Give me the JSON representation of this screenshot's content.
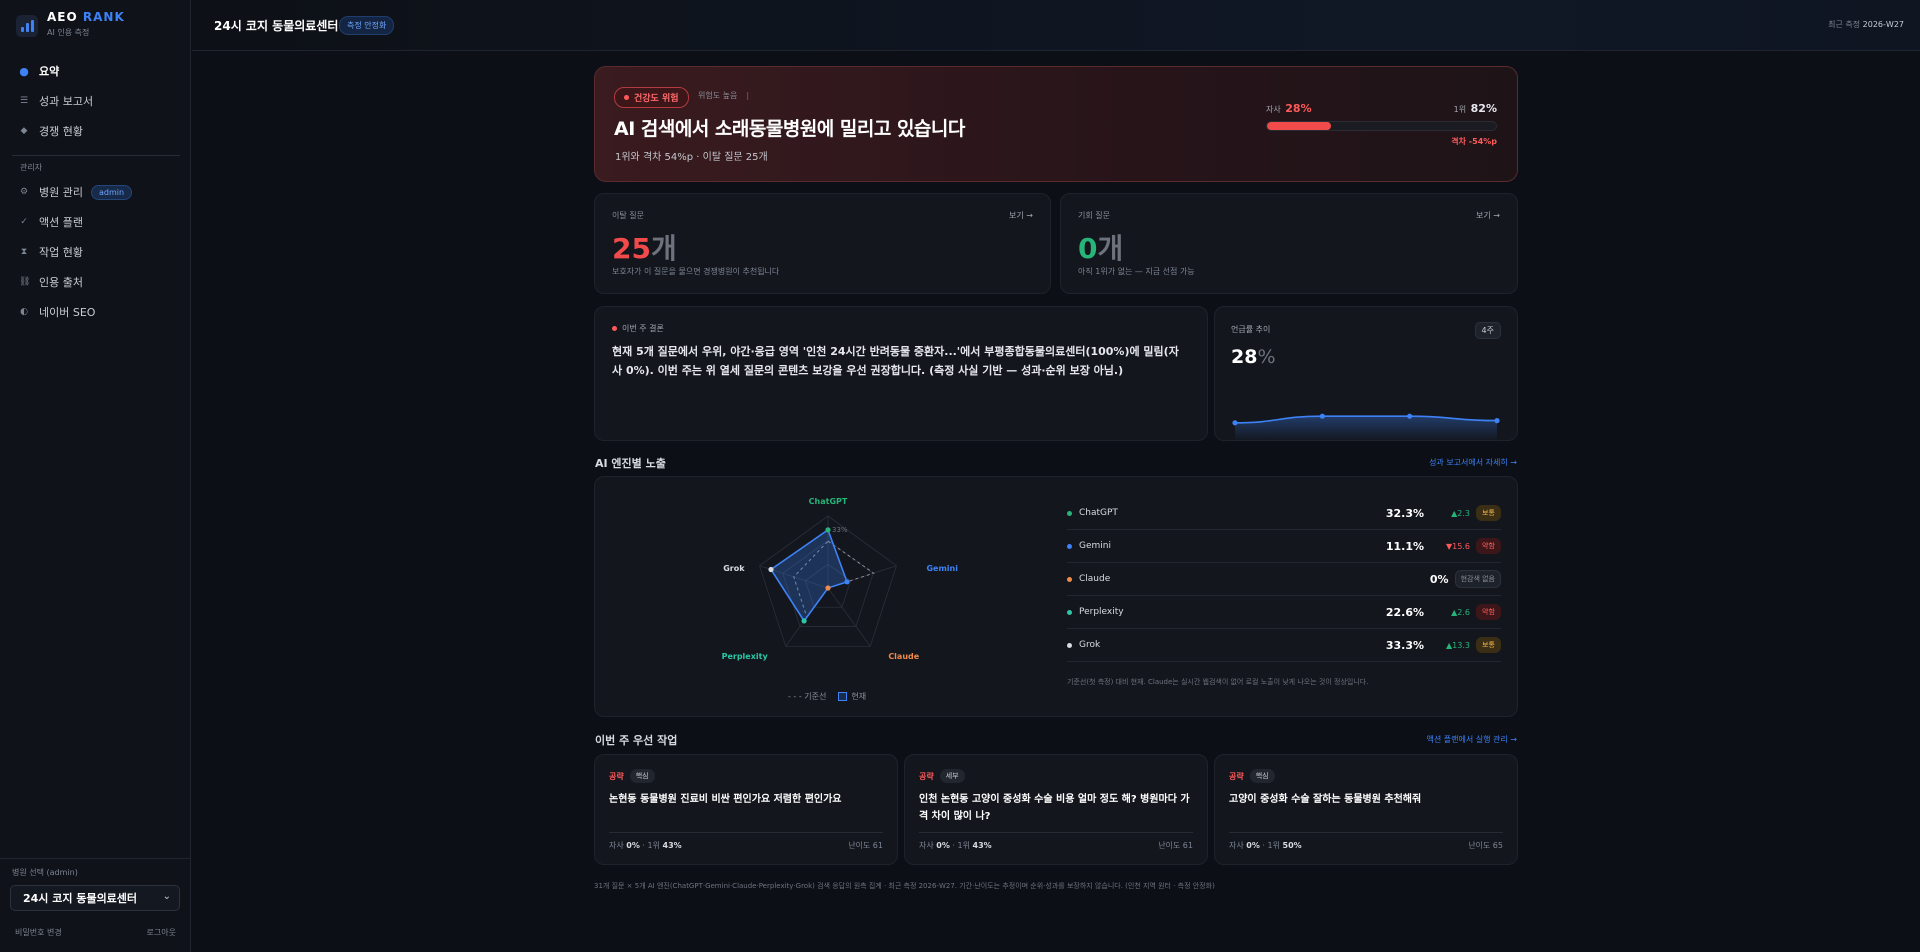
{
  "brand": {
    "name_a": "AEO",
    "name_b": "RANK",
    "subtitle": "AI 인용 측정"
  },
  "sidebar": {
    "items": [
      {
        "label": "요약",
        "icon": "dot-icon",
        "active": true
      },
      {
        "label": "성과 보고서",
        "icon": "list-icon"
      },
      {
        "label": "경쟁 현황",
        "icon": "diamond-icon"
      }
    ],
    "admin_section": "관리자",
    "admin_items": [
      {
        "label": "병원 관리",
        "icon": "gear-icon",
        "badge": "admin"
      },
      {
        "label": "액션 플랜",
        "icon": "check-icon"
      },
      {
        "label": "작업 현황",
        "icon": "hourglass-icon"
      },
      {
        "label": "인용 출처",
        "icon": "link-icon"
      },
      {
        "label": "네이버 SEO",
        "icon": "half-circle-icon"
      }
    ],
    "select_label": "병원 선택 (admin)",
    "selected_hospital": "24시 코지 동물의료센터",
    "change_password": "비밀번호 변경",
    "logout": "로그아웃"
  },
  "header": {
    "title": "24시 코지 동물의료센터",
    "badge": "측정 안정화",
    "latest_label": "최근 측정",
    "latest_value": "2026-W27"
  },
  "hero": {
    "pill": "건강도 위험",
    "meta": "위험도 높음",
    "meta_sep": "|",
    "title": "AI 검색에서 소래동물병원에 밀리고 있습니다",
    "subtitle": "1위와 격차 54%p · 이탈 질문 25개",
    "self_label": "자사",
    "self_value": "28%",
    "self_pct": 28,
    "top_label": "1위",
    "top_value": "82%",
    "gap": "격차 -54%p"
  },
  "lost_questions": {
    "label": "이탈 질문",
    "link": "보기 →",
    "num": "25",
    "unit": "개",
    "desc": "보호자가 이 질문을 물으면 경쟁병원이 추천됩니다"
  },
  "opportunity": {
    "label": "기회 질문",
    "link": "보기 →",
    "num": "0",
    "unit": "개",
    "desc": "아직 1위가 없는 — 지금 선점 가능"
  },
  "conclusion": {
    "label": "이번 주 결론",
    "text": "현재 5개 질문에서 우위, 야간·응급 영역 '인천 24시간 반려동물 중환자...'에서 부평종합동물의료센터(100%)에 밀림(자사 0%). 이번 주는 위 열세 질문의 콘텐츠 보강을 우선 권장합니다. (측정 사실 기반 — 성과·순위 보장 아님.)"
  },
  "trend": {
    "label": "언급률 추이",
    "badge": "4주",
    "value": "28",
    "unit": "%",
    "points": [
      26,
      29,
      29,
      27
    ]
  },
  "engines": {
    "title": "AI 엔진별 노출",
    "link": "성과 보고서에서 자세히 →",
    "radar_tick": "33%",
    "rows": [
      {
        "name": "ChatGPT",
        "color": "#28b479",
        "pct": "32.3%",
        "value": 32.3,
        "baseline": 26,
        "change": "▲2.3",
        "dir": "up",
        "tag": "보통",
        "tag_type": "ok"
      },
      {
        "name": "Gemini",
        "color": "#3d82f6",
        "pct": "11.1%",
        "value": 11.1,
        "baseline": 26.7,
        "change": "▼15.6",
        "dir": "down",
        "tag": "약함",
        "tag_type": "weak"
      },
      {
        "name": "Claude",
        "color": "#f08a4b",
        "pct": "0%",
        "value": 0,
        "baseline": 0,
        "change": "",
        "dir": "",
        "tag": "현감색 없음",
        "tag_type": "none"
      },
      {
        "name": "Perplexity",
        "color": "#2bc7a4",
        "pct": "22.6%",
        "value": 22.6,
        "baseline": 20,
        "change": "▲2.6",
        "dir": "up",
        "tag": "약함",
        "tag_type": "weak"
      },
      {
        "name": "Grok",
        "color": "#d8dbe2",
        "pct": "33.3%",
        "value": 33.3,
        "baseline": 20,
        "change": "▲13.3",
        "dir": "up",
        "tag": "보통",
        "tag_type": "ok"
      }
    ],
    "note": "기준선(첫 측정) 대비 현재. Claude는 실시간 웹검색이 없어 로컬 노출이 낮게 나오는 것이 정상입니다.",
    "legend_base": "기준선",
    "legend_current": "현재"
  },
  "tasks": {
    "title": "이번 주 우선 작업",
    "link": "액션 플랜에서 실행 관리 →",
    "items": [
      {
        "kind": "공략",
        "level": "핵심",
        "title": "논현동 동물병원 진료비 비싼 편인가요 저렴한 편인가요",
        "self": "0%",
        "top": "43%",
        "diff": "난이도 61"
      },
      {
        "kind": "공략",
        "level": "세부",
        "title": "인천 논현동 고양이 중성화 수술 비용 얼마 정도 해? 병원마다 가격 차이 많이 나?",
        "self": "0%",
        "top": "43%",
        "diff": "난이도 61"
      },
      {
        "kind": "공략",
        "level": "핵심",
        "title": "고양이 중성화 수술 잘하는 동물병원 추천해줘",
        "self": "0%",
        "top": "50%",
        "diff": "난이도 65"
      }
    ],
    "self_label": "자사",
    "top_label": "1위"
  },
  "footer_note": "31개 질문 × 5개 AI 엔진(ChatGPT·Gemini·Claude·Perplexity·Grok) 검색 응답의 원측 집계 · 최근 측정 2026-W27. 기간·난이도는 추정이며 순위·성과를 보장하지 않습니다. (인천 지역 원터 · 측정 안정화)"
}
